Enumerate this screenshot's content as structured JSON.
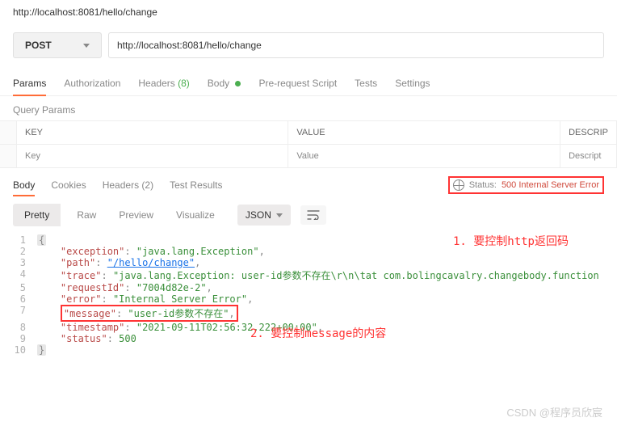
{
  "url_display": "http://localhost:8081/hello/change",
  "request": {
    "method": "POST",
    "url": "http://localhost:8081/hello/change"
  },
  "tabs": {
    "params": "Params",
    "authorization": "Authorization",
    "headers_label": "Headers",
    "headers_count": "(8)",
    "body": "Body",
    "prerequest": "Pre-request Script",
    "tests": "Tests",
    "settings": "Settings"
  },
  "query_params_label": "Query Params",
  "params_table": {
    "th_key": "KEY",
    "th_value": "VALUE",
    "th_desc": "DESCRIP",
    "ph_key": "Key",
    "ph_value": "Value",
    "ph_desc": "Descript"
  },
  "response_tabs": {
    "body": "Body",
    "cookies": "Cookies",
    "headers_label": "Headers",
    "headers_count": "(2)",
    "test_results": "Test Results"
  },
  "status": {
    "label": "Status:",
    "value": "500 Internal Server Error"
  },
  "viewer": {
    "pretty": "Pretty",
    "raw": "Raw",
    "preview": "Preview",
    "visualize": "Visualize",
    "format": "JSON"
  },
  "annotations": {
    "a1": "1. 要控制http返回码",
    "a2": "2. 要控制message的内容"
  },
  "json_body": {
    "k_exception": "\"exception\"",
    "v_exception": "\"java.lang.Exception\"",
    "k_path": "\"path\"",
    "v_path": "\"/hello/change\"",
    "k_trace": "\"trace\"",
    "v_trace": "\"java.lang.Exception: user-id参数不存在\\r\\n\\tat com.bolingcavalry.changebody.function",
    "k_requestId": "\"requestId\"",
    "v_requestId": "\"7004d82e-2\"",
    "k_error": "\"error\"",
    "v_error": "\"Internal Server Error\"",
    "k_message": "\"message\"",
    "v_message": "\"user-id参数不存在\"",
    "k_timestamp": "\"timestamp\"",
    "v_timestamp": "\"2021-09-11T02:56:32.222+00:00\"",
    "k_status": "\"status\"",
    "v_status": "500"
  },
  "watermark": "CSDN @程序员欣宸"
}
